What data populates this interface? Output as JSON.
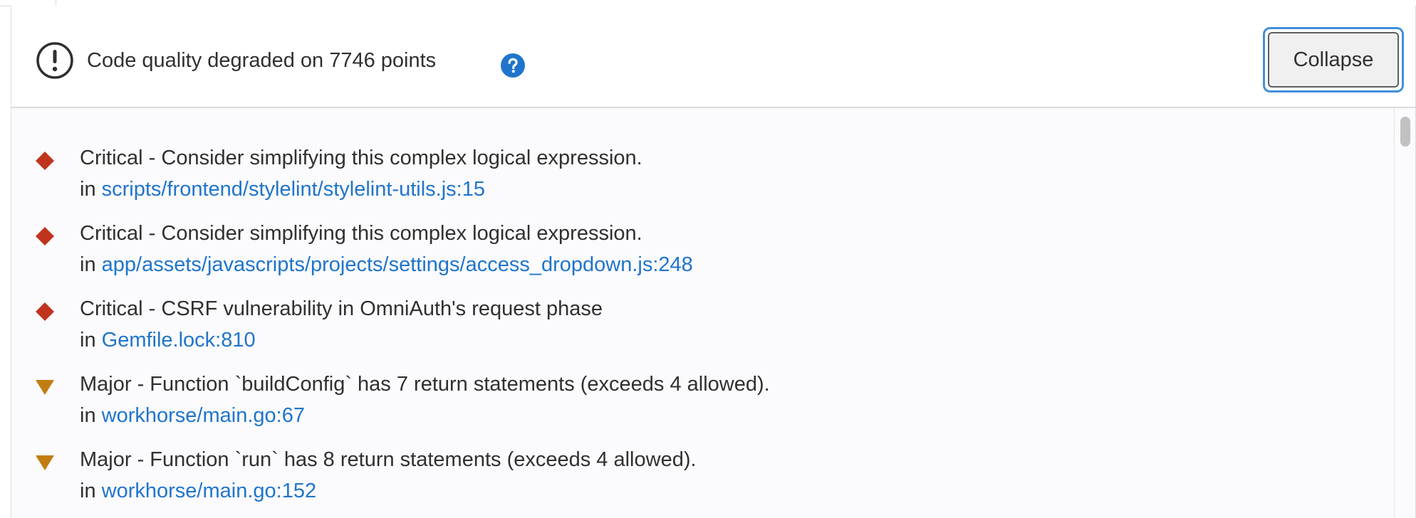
{
  "widget": {
    "summary": "Code quality degraded on 7746 points",
    "collapse_label": "Collapse",
    "help_icon": "question-circle-icon",
    "status_icon": "exclamation-circle-icon"
  },
  "issues": [
    {
      "severity": "critical",
      "icon": "diamond-icon",
      "description": "Critical - Consider simplifying this complex logical expression.",
      "prefix": "in",
      "location": "scripts/frontend/stylelint/stylelint-utils.js:15"
    },
    {
      "severity": "critical",
      "icon": "diamond-icon",
      "description": "Critical - Consider simplifying this complex logical expression.",
      "prefix": "in",
      "location": "app/assets/javascripts/projects/settings/access_dropdown.js:248"
    },
    {
      "severity": "critical",
      "icon": "diamond-icon",
      "description": "Critical - CSRF vulnerability in OmniAuth's request phase",
      "prefix": "in",
      "location": "Gemfile.lock:810"
    },
    {
      "severity": "major",
      "icon": "triangle-down-icon",
      "description": "Major - Function `buildConfig` has 7 return statements (exceeds 4 allowed).",
      "prefix": "in",
      "location": "workhorse/main.go:67"
    },
    {
      "severity": "major",
      "icon": "triangle-down-icon",
      "description": "Major - Function `run` has 8 return statements (exceeds 4 allowed).",
      "prefix": "in",
      "location": "workhorse/main.go:152"
    }
  ],
  "colors": {
    "critical": "#c0341d",
    "major": "#c17d10",
    "link": "#1f75cb",
    "focus_ring": "#428fdc",
    "help": "#1f75cb"
  }
}
